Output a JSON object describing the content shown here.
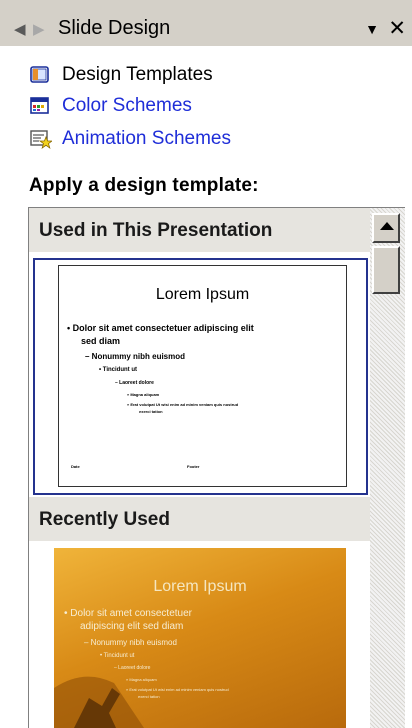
{
  "pane": {
    "title": "Slide Design"
  },
  "icons": {
    "back": "arrow-left-icon",
    "forward": "arrow-right-icon",
    "menu": "dropdown-arrow-icon",
    "close": "close-icon"
  },
  "links": [
    {
      "label": "Design Templates",
      "icon": "design-templates-icon",
      "color": "#000000"
    },
    {
      "label": "Color Schemes",
      "icon": "color-schemes-icon",
      "color": "#1f2ed8"
    },
    {
      "label": "Animation Schemes",
      "icon": "animation-schemes-icon",
      "color": "#1f2ed8"
    }
  ],
  "apply_heading": "Apply a design template:",
  "sections": {
    "used": "Used in This Presentation",
    "recent": "Recently Used"
  },
  "templates": {
    "used_thumb": {
      "title": "Lorem Ipsum",
      "bullets": [
        "• Dolor sit amet consectetuer adipiscing elit",
        "sed diam",
        "– Nonummy nibh euismod",
        "• Tincidunt ut",
        "– Laoreet dolore",
        "» Magna aliquam",
        "» Erat volutpat Ut wisi enim ad minim veniam quis nostrud",
        "exerci tation"
      ],
      "footer_left": "Date",
      "footer_mid": "Footer"
    },
    "recent_thumb": {
      "title": "Lorem Ipsum",
      "bullets": [
        "• Dolor sit amet consectetuer",
        "adipiscing elit sed diam",
        "– Nonummy nibh euismod",
        "• Tincidunt ut",
        "– Laoreet dolore",
        "» Magna aliquam",
        "» Erat volutpat Ut wisi enim ad minim veniam quis nostrud",
        "exerci tation"
      ]
    }
  },
  "colors": {
    "selection_border": "#24328e",
    "link": "#1f2ed8",
    "header_bg": "#d4d0c8"
  }
}
